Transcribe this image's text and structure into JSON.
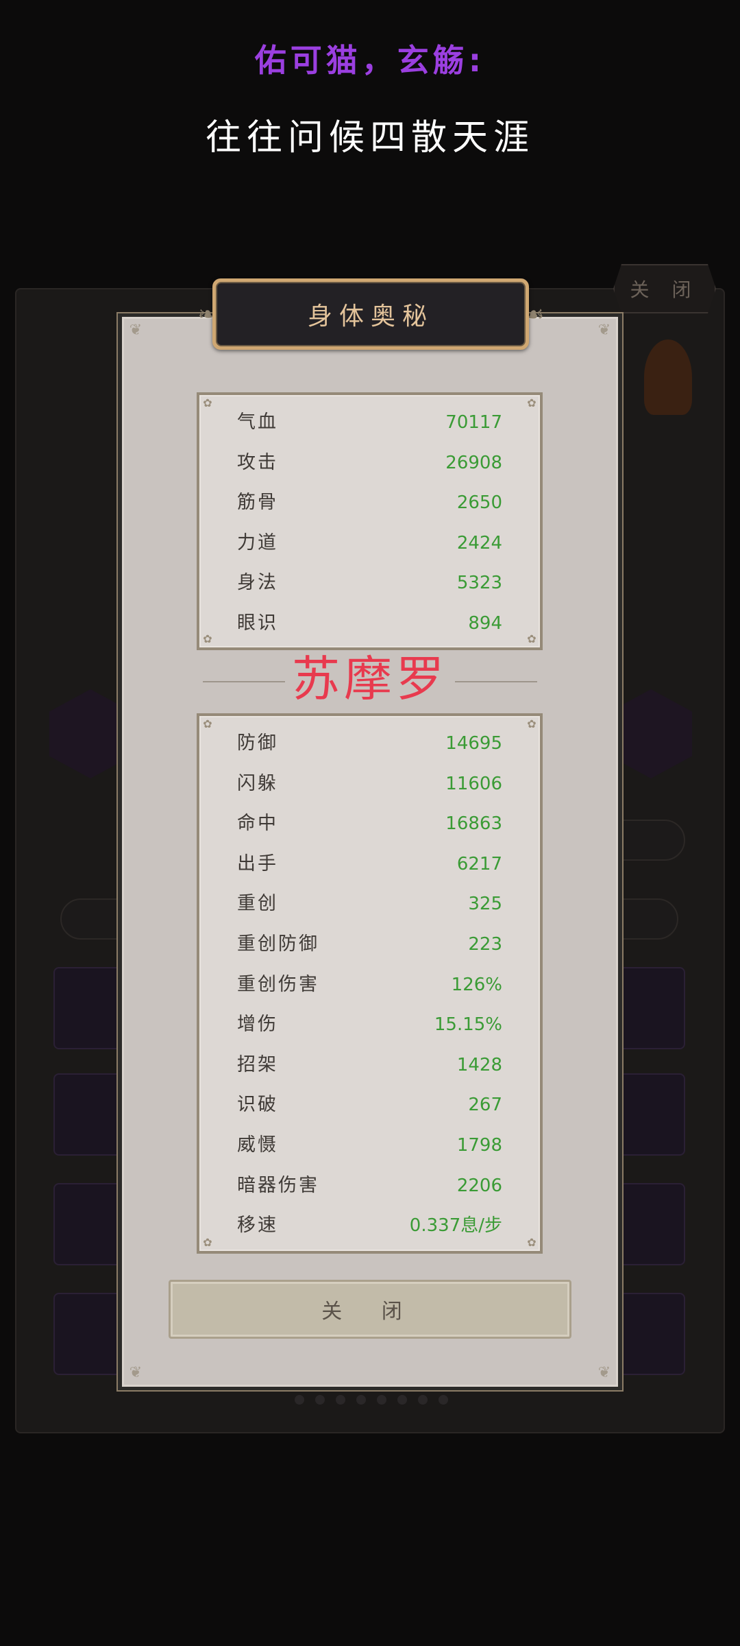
{
  "chat": {
    "author": "佑可猫，玄觞:",
    "message": "往往问候四散天涯"
  },
  "background": {
    "close_label": "关 闭"
  },
  "modal": {
    "title": "身体奥秘",
    "character_name": "苏摩罗",
    "close_label": "关 闭",
    "stats_group_1": [
      {
        "label": "气血",
        "value": "70117"
      },
      {
        "label": "攻击",
        "value": "26908"
      },
      {
        "label": "筋骨",
        "value": "2650"
      },
      {
        "label": "力道",
        "value": "2424"
      },
      {
        "label": "身法",
        "value": "5323"
      },
      {
        "label": "眼识",
        "value": "894"
      }
    ],
    "stats_group_2": [
      {
        "label": "防御",
        "value": "14695"
      },
      {
        "label": "闪躲",
        "value": "11606"
      },
      {
        "label": "命中",
        "value": "16863"
      },
      {
        "label": "出手",
        "value": "6217"
      },
      {
        "label": "重创",
        "value": "325"
      },
      {
        "label": "重创防御",
        "value": "223"
      },
      {
        "label": "重创伤害",
        "value": "126%"
      },
      {
        "label": "增伤",
        "value": "15.15%"
      },
      {
        "label": "招架",
        "value": "1428"
      },
      {
        "label": "识破",
        "value": "267"
      },
      {
        "label": "威慑",
        "value": "1798"
      },
      {
        "label": "暗器伤害",
        "value": "2206"
      },
      {
        "label": "移速",
        "value": "0.337息/步"
      }
    ]
  },
  "colors": {
    "author": "#9b3fe0",
    "stat_value": "#3a9b35",
    "character_name": "#e83a4e",
    "title_text": "#e4c49b"
  }
}
